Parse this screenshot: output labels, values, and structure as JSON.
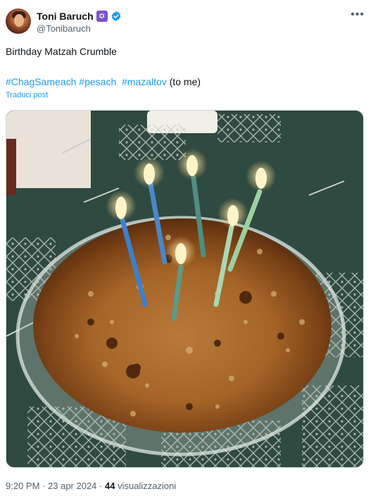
{
  "author": {
    "display_name": "Toni Baruch",
    "handle": "@Tonibaruch",
    "badge_icon": "star-of-david-icon",
    "verified_icon": "verified-badge-icon",
    "badge_color": "#7b52c6",
    "verified_color": "#1d9bf0"
  },
  "post": {
    "text": "Birthday Matzah Crumble",
    "hashtags": [
      "#ChagSameach",
      "#pesach",
      "#mazaltov"
    ],
    "trailing_text": "(to me)",
    "translate_label": "Traduci post",
    "link_color": "#1d9bf0"
  },
  "meta": {
    "time": "9:20 PM",
    "separator": "·",
    "date": "23 apr 2024",
    "views_count": "44",
    "views_label": "visualizzazioni"
  },
  "more_icon": "more-options-icon"
}
